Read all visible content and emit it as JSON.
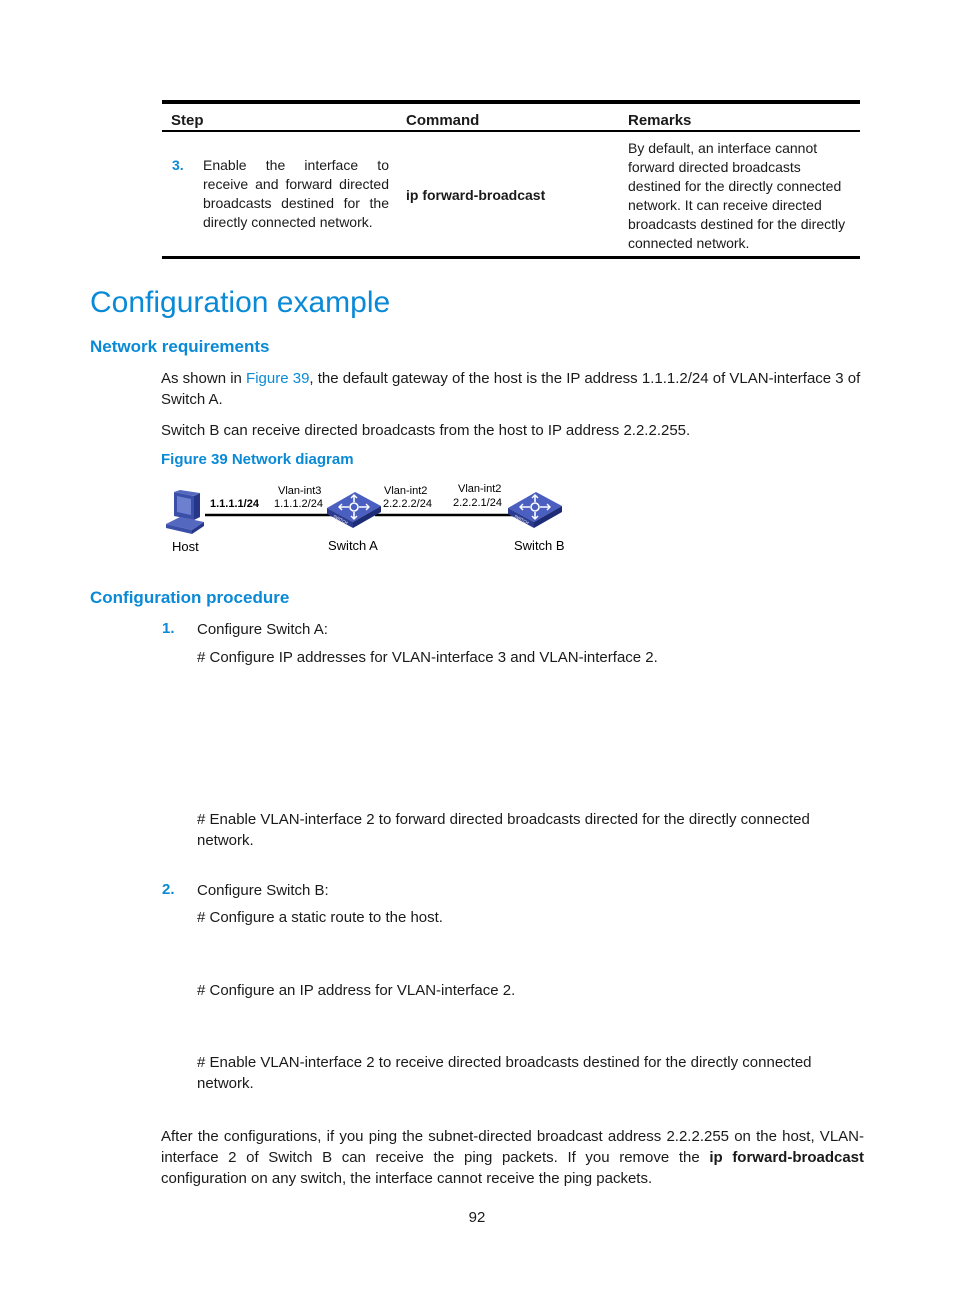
{
  "table": {
    "headers": [
      "Step",
      "Command",
      "Remarks"
    ],
    "rows": [
      {
        "step_number": "3.",
        "step_text": "Enable the interface to receive and forward directed broadcasts destined for the directly connected network.",
        "command": "ip forward-broadcast",
        "remarks": "By default, an interface cannot forward directed broadcasts destined for the directly connected network. It can receive directed broadcasts destined for the directly connected network."
      }
    ]
  },
  "section_title": "Configuration example",
  "network_requirements": {
    "heading": "Network requirements",
    "para1_prefix": "As shown in ",
    "para1_link": "Figure 39",
    "para1_suffix": ", the default gateway of the host is the IP address 1.1.1.2/24 of VLAN-interface 3 of Switch A.",
    "para2": "Switch B can receive directed broadcasts from the host to IP address 2.2.2.255.",
    "figure_caption": "Figure 39 Network diagram"
  },
  "diagram": {
    "nodes": [
      {
        "label": "Host",
        "icon": "computer-icon"
      },
      {
        "label": "Switch A",
        "icon": "switch-icon"
      },
      {
        "label": "Switch B",
        "icon": "switch-icon"
      }
    ],
    "labels": {
      "host_ip": "1.1.1.1/24",
      "a_vlan3_name": "Vlan-int3",
      "a_vlan3_ip": "1.1.1.2/24",
      "a_vlan2_name": "Vlan-int2",
      "a_vlan2_ip": "2.2.2.2/24",
      "b_vlan2_name": "Vlan-int2",
      "b_vlan2_ip": "2.2.2.1/24"
    },
    "switch_badge": "SWITCH"
  },
  "procedure": {
    "heading": "Configuration procedure",
    "steps": [
      {
        "number": "1.",
        "label": "Configure Switch A:",
        "notes": [
          "# Configure IP addresses for VLAN-interface 3 and VLAN-interface 2.",
          "# Enable VLAN-interface 2 to forward directed broadcasts directed for the directly connected network."
        ]
      },
      {
        "number": "2.",
        "label": "Configure Switch B:",
        "notes": [
          "# Configure a static route to the host.",
          "# Configure an IP address for VLAN-interface 2.",
          "# Enable VLAN-interface 2 to receive directed broadcasts destined for the directly connected network."
        ]
      }
    ]
  },
  "conclusion": {
    "prefix": "After the configurations, if you ping the subnet-directed broadcast address 2.2.2.255 on the host, VLAN-interface 2 of Switch B can receive the ping packets. If you remove the ",
    "bold": "ip forward-broadcast",
    "suffix": " configuration on any switch, the interface cannot receive the ping packets."
  },
  "page_number": "92",
  "colors": {
    "accent": "#0a8ad6",
    "text": "#1a1a1a",
    "device": "#3a4fa8"
  }
}
